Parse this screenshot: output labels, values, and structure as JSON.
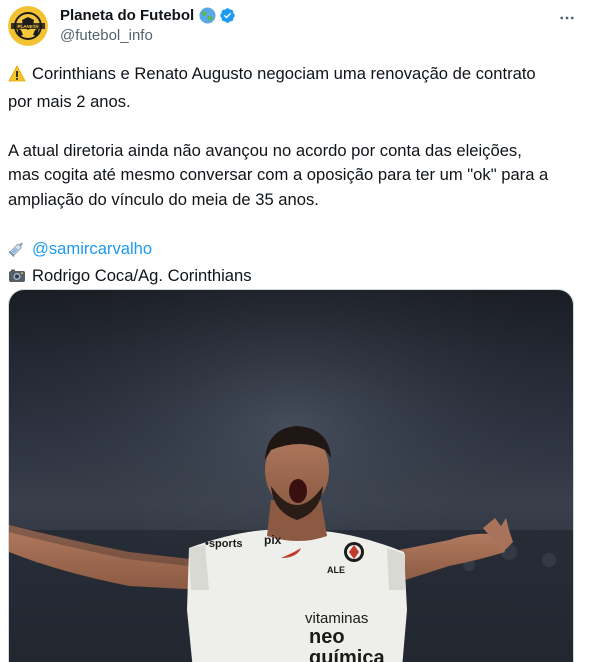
{
  "author": {
    "display_name": "Planeta do Futebol",
    "handle": "@futebol_info",
    "globe_icon": "globe-emoji-icon",
    "verified_icon": "verified-badge-icon",
    "verified_color": "#1d9bf0"
  },
  "tweet": {
    "line1": "Corinthians e Renato Augusto negociam uma renovação de contrato",
    "line2": "por mais 2 anos.",
    "para2_line1": "A atual diretoria ainda não avançou no acordo por conta das eleições,",
    "para2_line2": "mas cogita até mesmo conversar com a oposição para ter um \"ok\" para a",
    "para2_line3": "ampliação do vínculo do meia de 35 anos.",
    "source_mention": "@samircarvalho",
    "photo_credit": "Rodrigo Coca/Ag. Corinthians",
    "warning_icon": "warning-emoji-icon",
    "syringe_icon": "syringe-emoji-icon",
    "camera_icon": "camera-emoji-icon"
  },
  "media": {
    "shirt_sponsor_brand": "•sports",
    "shirt_brand": "pix",
    "shirt_left_logo": "ALE",
    "sponsor_line1": "vitaminas",
    "sponsor_line2": "neo",
    "sponsor_line3": "química"
  },
  "colors": {
    "link": "#1d9bf0",
    "text": "#0f1419",
    "secondary": "#536471"
  }
}
